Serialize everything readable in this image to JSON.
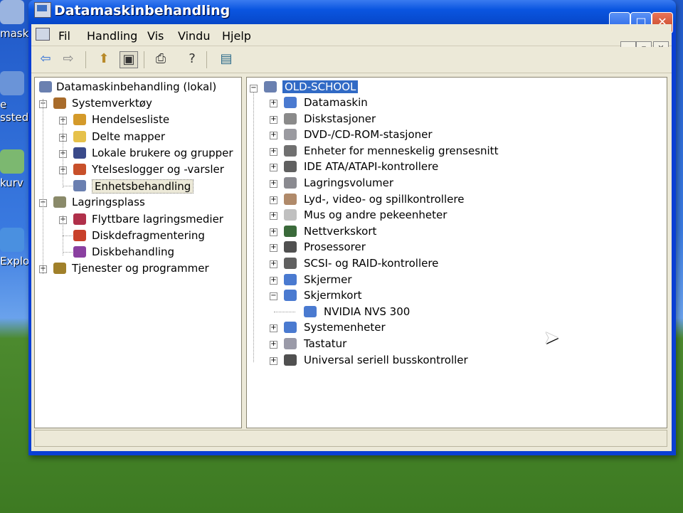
{
  "window": {
    "title": "Datamaskinbehandling",
    "controls": {
      "minimize": "_",
      "maximize": "□",
      "close": "✕"
    }
  },
  "desktop": {
    "icons": [
      {
        "label": "maski",
        "icon": "my-computer-icon",
        "color": "#9ab4e0"
      },
      {
        "label": "e\nsstede",
        "icon": "network-places-icon",
        "color": "#6a94d8"
      },
      {
        "label": "kurv",
        "icon": "recycle-bin-icon",
        "color": "#7cb870"
      },
      {
        "label": "Explor",
        "icon": "internet-explorer-icon",
        "color": "#4a90e0"
      }
    ]
  },
  "menubar": {
    "items": [
      "Fil",
      "Handling",
      "Vis",
      "Vindu",
      "Hjelp"
    ],
    "mdi_controls": [
      "_",
      "▫",
      "✕"
    ]
  },
  "toolbar": {
    "buttons": [
      {
        "icon": "back-arrow-icon",
        "glyph": "⇦"
      },
      {
        "icon": "forward-arrow-icon",
        "glyph": "⇨"
      },
      {
        "icon": "up-folder-icon",
        "glyph": "⬆"
      },
      {
        "icon": "show-hide-tree-icon",
        "glyph": "▣"
      },
      {
        "icon": "print-icon",
        "glyph": "⎙"
      },
      {
        "icon": "help-icon",
        "glyph": "?"
      },
      {
        "icon": "properties-icon",
        "glyph": "▤"
      }
    ]
  },
  "left_tree": {
    "root": "Datamaskinbehandling (lokal)",
    "items": [
      {
        "level": 1,
        "label": "Systemverktøy",
        "expander": "−",
        "icon": "system-tools-icon",
        "color": "#a86b2a"
      },
      {
        "level": 2,
        "label": "Hendelsesliste",
        "expander": "+",
        "icon": "event-viewer-icon",
        "color": "#d49a2a"
      },
      {
        "level": 2,
        "label": "Delte mapper",
        "expander": "+",
        "icon": "shared-folders-icon",
        "color": "#e6c14a"
      },
      {
        "level": 2,
        "label": "Lokale brukere og grupper",
        "expander": "+",
        "icon": "local-users-icon",
        "color": "#3a4a8a"
      },
      {
        "level": 2,
        "label": "Ytelseslogger og -varsler",
        "expander": "+",
        "icon": "performance-logs-icon",
        "color": "#c8502a"
      },
      {
        "level": 2,
        "label": "Enhetsbehandling",
        "expander": "",
        "icon": "device-manager-icon",
        "color": "#6a7fb0",
        "selected": true
      },
      {
        "level": 1,
        "label": "Lagringsplass",
        "expander": "−",
        "icon": "storage-icon",
        "color": "#8a8a6a"
      },
      {
        "level": 2,
        "label": "Flyttbare lagringsmedier",
        "expander": "+",
        "icon": "removable-storage-icon",
        "color": "#b0304a"
      },
      {
        "level": 2,
        "label": "Diskdefragmentering",
        "expander": "",
        "icon": "disk-defrag-icon",
        "color": "#c8402a"
      },
      {
        "level": 2,
        "label": "Diskbehandling",
        "expander": "",
        "icon": "disk-management-icon",
        "color": "#8a40a0"
      },
      {
        "level": 1,
        "label": "Tjenester og programmer",
        "expander": "+",
        "icon": "services-applications-icon",
        "color": "#a0802a"
      }
    ]
  },
  "right_tree": {
    "root": "OLD-SCHOOL",
    "items": [
      {
        "label": "Datamaskin",
        "expander": "+",
        "icon": "computer-icon",
        "color": "#4a7ad0"
      },
      {
        "label": "Diskstasjoner",
        "expander": "+",
        "icon": "disk-drive-icon",
        "color": "#8a8a8a"
      },
      {
        "label": "DVD-/CD-ROM-stasjoner",
        "expander": "+",
        "icon": "cd-drive-icon",
        "color": "#9a9aa0"
      },
      {
        "label": "Enheter for menneskelig grensesnitt",
        "expander": "+",
        "icon": "hid-icon",
        "color": "#707070"
      },
      {
        "label": "IDE ATA/ATAPI-kontrollere",
        "expander": "+",
        "icon": "ide-controller-icon",
        "color": "#606060"
      },
      {
        "label": "Lagringsvolumer",
        "expander": "+",
        "icon": "storage-volume-icon",
        "color": "#8a8a90"
      },
      {
        "label": "Lyd-, video- og spillkontrollere",
        "expander": "+",
        "icon": "sound-video-icon",
        "color": "#b08a6a"
      },
      {
        "label": "Mus og andre pekeenheter",
        "expander": "+",
        "icon": "mouse-icon",
        "color": "#c0c0c0"
      },
      {
        "label": "Nettverkskort",
        "expander": "+",
        "icon": "network-adapter-icon",
        "color": "#3a6a3a"
      },
      {
        "label": "Prosessorer",
        "expander": "+",
        "icon": "processor-icon",
        "color": "#505050"
      },
      {
        "label": "SCSI- og RAID-kontrollere",
        "expander": "+",
        "icon": "scsi-raid-icon",
        "color": "#606060"
      },
      {
        "label": "Skjermer",
        "expander": "+",
        "icon": "monitor-icon",
        "color": "#4a7ad0"
      },
      {
        "label": "Skjermkort",
        "expander": "−",
        "icon": "display-adapter-icon",
        "color": "#4a7ad0"
      },
      {
        "label": "NVIDIA NVS 300",
        "expander": "",
        "icon": "display-adapter-icon",
        "color": "#4a7ad0",
        "child": true
      },
      {
        "label": "Systemenheter",
        "expander": "+",
        "icon": "system-devices-icon",
        "color": "#4a7ad0"
      },
      {
        "label": "Tastatur",
        "expander": "+",
        "icon": "keyboard-icon",
        "color": "#9a9aa8"
      },
      {
        "label": "Universal seriell busskontroller",
        "expander": "+",
        "icon": "usb-icon",
        "color": "#505050"
      }
    ]
  }
}
